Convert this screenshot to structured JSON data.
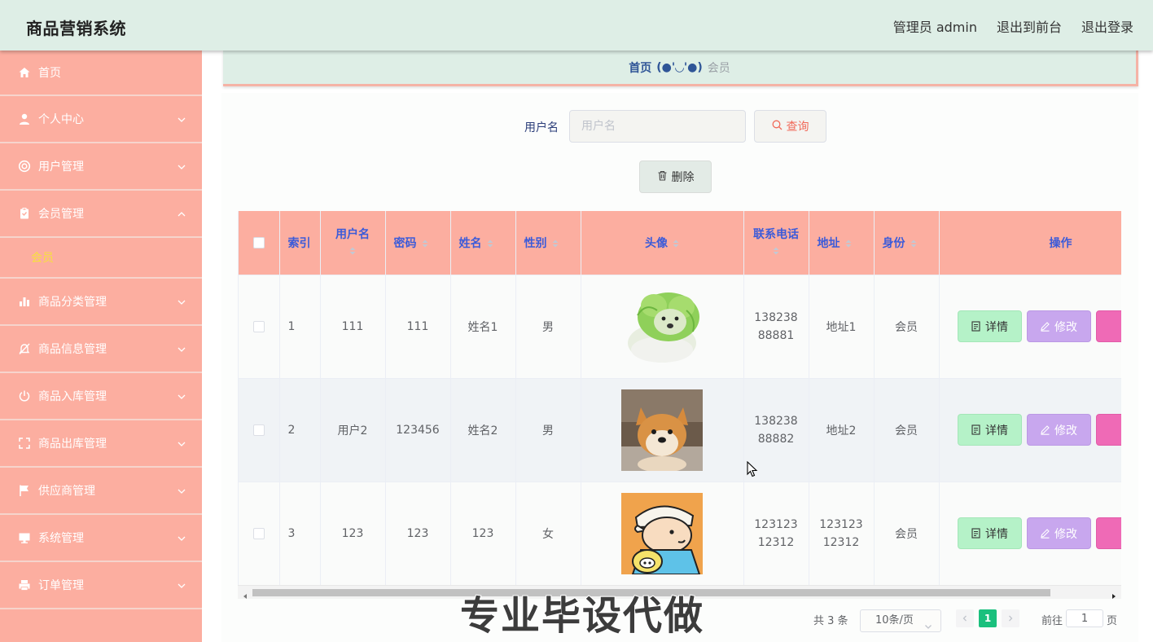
{
  "app": {
    "title": "商品营销系统",
    "admin_label": "管理员 admin",
    "to_front": "退出到前台",
    "logout": "退出登录"
  },
  "sidebar": {
    "items": [
      {
        "label": "首页",
        "icon": "home-icon"
      },
      {
        "label": "个人中心",
        "icon": "user-icon"
      },
      {
        "label": "用户管理",
        "icon": "lifebuoy-icon"
      },
      {
        "label": "会员管理",
        "icon": "clipboard-icon",
        "expanded": true
      },
      {
        "label": "商品分类管理",
        "icon": "bar-chart-icon"
      },
      {
        "label": "商品信息管理",
        "icon": "bell-off-icon"
      },
      {
        "label": "商品入库管理",
        "icon": "power-icon"
      },
      {
        "label": "商品出库管理",
        "icon": "fullscreen-icon"
      },
      {
        "label": "供应商管理",
        "icon": "flag-icon"
      },
      {
        "label": "系统管理",
        "icon": "monitor-icon"
      },
      {
        "label": "订单管理",
        "icon": "printer-icon"
      }
    ],
    "submenu_active": "会员"
  },
  "breadcrumb": {
    "home": "首页",
    "separator": "(●'◡'●)",
    "current": "会员"
  },
  "search": {
    "label": "用户名",
    "placeholder": "用户名",
    "value": "",
    "query_button": "查询"
  },
  "actions": {
    "delete_button": "删除"
  },
  "table": {
    "columns": [
      "索引",
      "用户名",
      "密码",
      "姓名",
      "性别",
      "头像",
      "联系电话",
      "地址",
      "身份",
      "操作"
    ],
    "rows": [
      {
        "index": "1",
        "username": "111",
        "password": "111",
        "name": "姓名1",
        "gender": "男",
        "avatar": "cabbage-dog-avatar",
        "phone": "13823888881",
        "address": "地址1",
        "role": "会员"
      },
      {
        "index": "2",
        "username": "用户2",
        "password": "123456",
        "name": "姓名2",
        "gender": "男",
        "avatar": "shiba-dog-avatar",
        "phone": "13823888882",
        "address": "地址2",
        "role": "会员"
      },
      {
        "index": "3",
        "username": "123",
        "password": "123",
        "name": "123",
        "gender": "女",
        "avatar": "cartoon-boy-avatar",
        "phone": "12312312312",
        "address": "12312312312",
        "role": "会员"
      }
    ],
    "row_buttons": {
      "detail": "详情",
      "edit": "修改"
    }
  },
  "pagination": {
    "total": "共 3 条",
    "page_size": "10条/页",
    "current_page": "1",
    "goto_label": "前往",
    "goto_value": "1",
    "page_suffix": "页"
  },
  "watermark": "专业毕设代做",
  "colors": {
    "header_bg": "#deeee6",
    "sidebar_bg": "#fcaea0",
    "table_header_bg": "#fcaea0",
    "header_text": "#3b5bd9",
    "submenu_active": "#f7e13c",
    "detail_btn": "#b5f2c8",
    "edit_btn": "#c8a7ee",
    "delete_btn": "#ef6ab6",
    "page_active": "#1ac07d"
  }
}
